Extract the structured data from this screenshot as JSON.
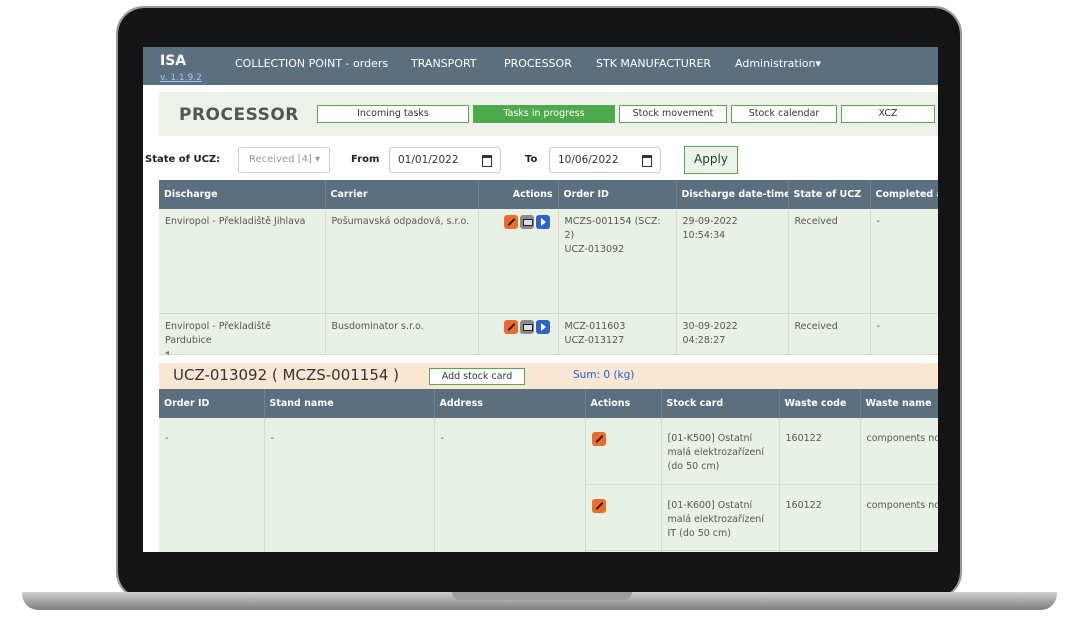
{
  "nav": {
    "brand": "ISA",
    "version": "v. 1.1.9.2",
    "items": [
      "COLLECTION POINT - orders",
      "TRANSPORT",
      "PROCESSOR",
      "STK MANUFACTURER",
      "Administration▾"
    ]
  },
  "header": {
    "title": "PROCESSOR",
    "tabs": [
      "Incoming tasks",
      "Tasks in progress",
      "Stock movement",
      "Stock calendar",
      "XCZ"
    ],
    "active_tab": "Tasks in progress"
  },
  "filters": {
    "state_label": "State of UCZ:",
    "state_value": "Received [4] ▾",
    "from_label": "From",
    "from_value": "01/01/2022",
    "to_label": "To",
    "to_value": "10/06/2022",
    "apply_label": "Apply"
  },
  "orders_table": {
    "columns": [
      "Discharge",
      "Carrier",
      "Actions",
      "Order ID",
      "Discharge date-time",
      "State of UCZ",
      "Completed at"
    ],
    "rows": [
      {
        "discharge": "Enviropol - Překladiště Jihlava",
        "carrier": "Pošumavská odpadová, s.r.o.",
        "order_id": "MCZS-001154 (SCZ: 2)",
        "order_ucz": "UCZ-013092",
        "date": "29-09-2022",
        "time": "10:54:34",
        "state": "Received",
        "completed": "-"
      },
      {
        "discharge": "Enviropol - Překladiště Pardubice",
        "carrier": "Busdominator s.r.o.",
        "order_id": "MCZ-011603",
        "order_ucz": "UCZ-013127",
        "date": "30-09-2022",
        "time": "04:28:27",
        "state": "Received",
        "completed": "-"
      }
    ]
  },
  "detail": {
    "title": "UCZ-013092 ( MCZS-001154 )",
    "add_label": "Add stock card",
    "sum": "Sum: 0 (kg)"
  },
  "stock_table": {
    "columns": [
      "Order ID",
      "Stand name",
      "Address",
      "Actions",
      "Stock card",
      "Waste code",
      "Waste name"
    ],
    "order_id": "-",
    "stand": "-",
    "address": "-",
    "rows": [
      {
        "card": "[01-K500] Ostatní malá elektrozařízení (do 50 cm)",
        "code": "160122",
        "name": "components not specified"
      },
      {
        "card": "[01-K600] Ostatní malá elektrozařízení IT (do 50 cm)",
        "code": "160122",
        "name": "components not specified"
      }
    ]
  },
  "colors": {
    "navbar": "#5b6f7e",
    "active_tab": "#4caa4c",
    "row_bg": "#e9f1e6",
    "detail_bar": "#f9e7d3",
    "edit_icon": "#ee6b2e",
    "go_icon": "#2e63c9"
  }
}
